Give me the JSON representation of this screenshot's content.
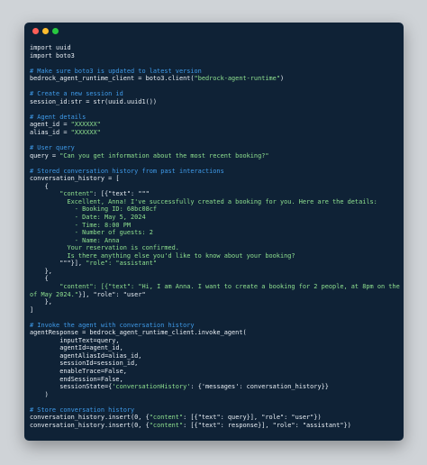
{
  "window": {
    "controls": [
      "close-button",
      "minimize-button",
      "zoom-button"
    ]
  },
  "code_lines": [
    {
      "kind": "p",
      "text": "import uuid"
    },
    {
      "kind": "p",
      "text": "import boto3"
    },
    {
      "kind": "p",
      "text": ""
    },
    {
      "kind": "c",
      "text": "# Make sure boto3 is updated to latest version"
    },
    {
      "kind": "m",
      "pre": "bedrock_agent_runtime_client = boto3.client(",
      "str": "\"bedrock-agent-runtime\"",
      "post": ")"
    },
    {
      "kind": "p",
      "text": ""
    },
    {
      "kind": "c",
      "text": "# Create a new session id"
    },
    {
      "kind": "p",
      "text": "session_id:str = str(uuid.uuid1())"
    },
    {
      "kind": "p",
      "text": ""
    },
    {
      "kind": "c",
      "text": "# Agent details"
    },
    {
      "kind": "m",
      "pre": "agent_id = ",
      "str": "\"XXXXXX\"",
      "post": ""
    },
    {
      "kind": "m",
      "pre": "alias_id = ",
      "str": "\"XXXXXX\"",
      "post": ""
    },
    {
      "kind": "p",
      "text": ""
    },
    {
      "kind": "c",
      "text": "# User query"
    },
    {
      "kind": "m",
      "pre": "query = ",
      "str": "\"Can you get information about the most recent booking?\"",
      "post": ""
    },
    {
      "kind": "p",
      "text": ""
    },
    {
      "kind": "c",
      "text": "# Stored conversation history from past interactions"
    },
    {
      "kind": "p",
      "text": "conversation_history = ["
    },
    {
      "kind": "p",
      "text": "    {"
    },
    {
      "kind": "m",
      "pre": "        ",
      "str": "\"content\"",
      "post": ": [{\"text\": \"\"\""
    },
    {
      "kind": "s",
      "text": "          Excellent, Anna! I've successfully created a booking for you. Here are the details:"
    },
    {
      "kind": "s",
      "text": "            - Booking ID: 68bc08cf"
    },
    {
      "kind": "s",
      "text": "            - Date: May 5, 2024"
    },
    {
      "kind": "s",
      "text": "            - Time: 8:00 PM"
    },
    {
      "kind": "s",
      "text": "            - Number of guests: 2"
    },
    {
      "kind": "s",
      "text": "            - Name: Anna"
    },
    {
      "kind": "s",
      "text": "          Your reservation is confirmed."
    },
    {
      "kind": "s",
      "text": "          Is there anything else you'd like to know about your booking?"
    },
    {
      "kind": "m",
      "pre": "        \"\"\"}], ",
      "str": "\"role\": \"assistant\"",
      "post": ""
    },
    {
      "kind": "p",
      "text": "    },"
    },
    {
      "kind": "p",
      "text": "    {"
    },
    {
      "kind": "m",
      "pre": "        ",
      "str": "\"content\": [{\"text\": \"Hi, I am Anna. I want to create a booking for 2 people, at 8pm on the 5th",
      "post": ""
    },
    {
      "kind": "m",
      "pre": "",
      "str": "of May 2024.\"",
      "post": "}], \"role\": \"user\""
    },
    {
      "kind": "p",
      "text": "    },"
    },
    {
      "kind": "p",
      "text": "]"
    },
    {
      "kind": "p",
      "text": ""
    },
    {
      "kind": "c",
      "text": "# Invoke the agent with conversation history"
    },
    {
      "kind": "p",
      "text": "agentResponse = bedrock_agent_runtime_client.invoke_agent("
    },
    {
      "kind": "p",
      "text": "        inputText=query,"
    },
    {
      "kind": "p",
      "text": "        agentId=agent_id,"
    },
    {
      "kind": "p",
      "text": "        agentAliasId=alias_id,"
    },
    {
      "kind": "p",
      "text": "        sessionId=session_id,"
    },
    {
      "kind": "p",
      "text": "        enableTrace=False,"
    },
    {
      "kind": "p",
      "text": "        endSession=False,"
    },
    {
      "kind": "m",
      "pre": "        sessionState={",
      "str": "'conversationHistory'",
      "post": ": {'messages': conversation_history}}"
    },
    {
      "kind": "p",
      "text": "    )"
    },
    {
      "kind": "p",
      "text": ""
    },
    {
      "kind": "c",
      "text": "# Store conversation history"
    },
    {
      "kind": "m",
      "pre": "conversation_history.insert(0, {",
      "str": "\"content\"",
      "post": ": [{\"text\": query}], \"role\": \"user\"})"
    },
    {
      "kind": "m",
      "pre": "conversation_history.insert(0, {",
      "str": "\"content\"",
      "post": ": [{\"text\": response}], \"role\": \"assistant\"})"
    }
  ]
}
